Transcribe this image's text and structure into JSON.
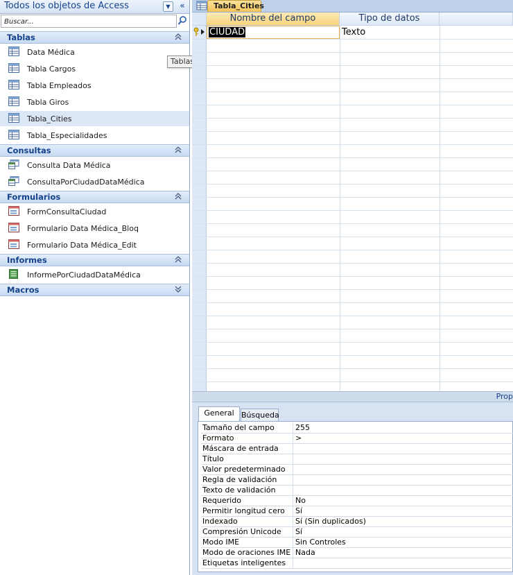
{
  "nav": {
    "title": "Todos los objetos de Access",
    "search_placeholder": "Buscar...",
    "tooltip": "Tablas",
    "groups": [
      {
        "label": "Tablas",
        "chevron": "up",
        "items": [
          {
            "label": "Data Médica",
            "icon": "table-icon"
          },
          {
            "label": "Tabla Cargos",
            "icon": "table-icon"
          },
          {
            "label": "Tabla Empleados",
            "icon": "table-icon"
          },
          {
            "label": "Tabla Giros",
            "icon": "table-icon"
          },
          {
            "label": "Tabla_Cities",
            "icon": "table-icon",
            "selected": true
          },
          {
            "label": "Tabla_Especialidades",
            "icon": "table-icon"
          }
        ]
      },
      {
        "label": "Consultas",
        "chevron": "up",
        "items": [
          {
            "label": "Consulta Data Médica",
            "icon": "query-icon"
          },
          {
            "label": "ConsultaPorCiudadDataMédica",
            "icon": "query-icon"
          }
        ]
      },
      {
        "label": "Formularios",
        "chevron": "up",
        "items": [
          {
            "label": "FormConsultaCiudad",
            "icon": "form-icon"
          },
          {
            "label": "Formulario Data Médica_Bloq",
            "icon": "form-icon"
          },
          {
            "label": "Formulario Data Médica_Edit",
            "icon": "form-icon"
          }
        ]
      },
      {
        "label": "Informes",
        "chevron": "up",
        "items": [
          {
            "label": "InformePorCiudadDataMédica",
            "icon": "report-icon"
          }
        ]
      },
      {
        "label": "Macros",
        "chevron": "down",
        "items": []
      }
    ]
  },
  "document": {
    "tab_label": "Tabla_Cities",
    "columns": {
      "name": "Nombre del campo",
      "type": "Tipo de datos"
    },
    "rows": [
      {
        "name": "CIUDAD",
        "type": "Texto",
        "primary_key": true
      }
    ],
    "properties_label": "Prop"
  },
  "properties": {
    "tabs": [
      "General",
      "Búsqueda"
    ],
    "rows": [
      {
        "name": "Tamaño del campo",
        "value": "255"
      },
      {
        "name": "Formato",
        "value": ">"
      },
      {
        "name": "Máscara de entrada",
        "value": ""
      },
      {
        "name": "Título",
        "value": ""
      },
      {
        "name": "Valor predeterminado",
        "value": ""
      },
      {
        "name": "Regla de validación",
        "value": ""
      },
      {
        "name": "Texto de validación",
        "value": ""
      },
      {
        "name": "Requerido",
        "value": "No"
      },
      {
        "name": "Permitir longitud cero",
        "value": "Sí"
      },
      {
        "name": "Indexado",
        "value": "Sí (Sin duplicados)"
      },
      {
        "name": "Compresión Unicode",
        "value": "Sí"
      },
      {
        "name": "Modo IME",
        "value": "Sin Controles"
      },
      {
        "name": "Modo de oraciones IME",
        "value": "Nada"
      },
      {
        "name": "Etiquetas inteligentes",
        "value": ""
      }
    ]
  },
  "colors": {
    "accent": "#15428b",
    "tab_active": "#f6c35b",
    "selection": "#dbe7f6"
  }
}
